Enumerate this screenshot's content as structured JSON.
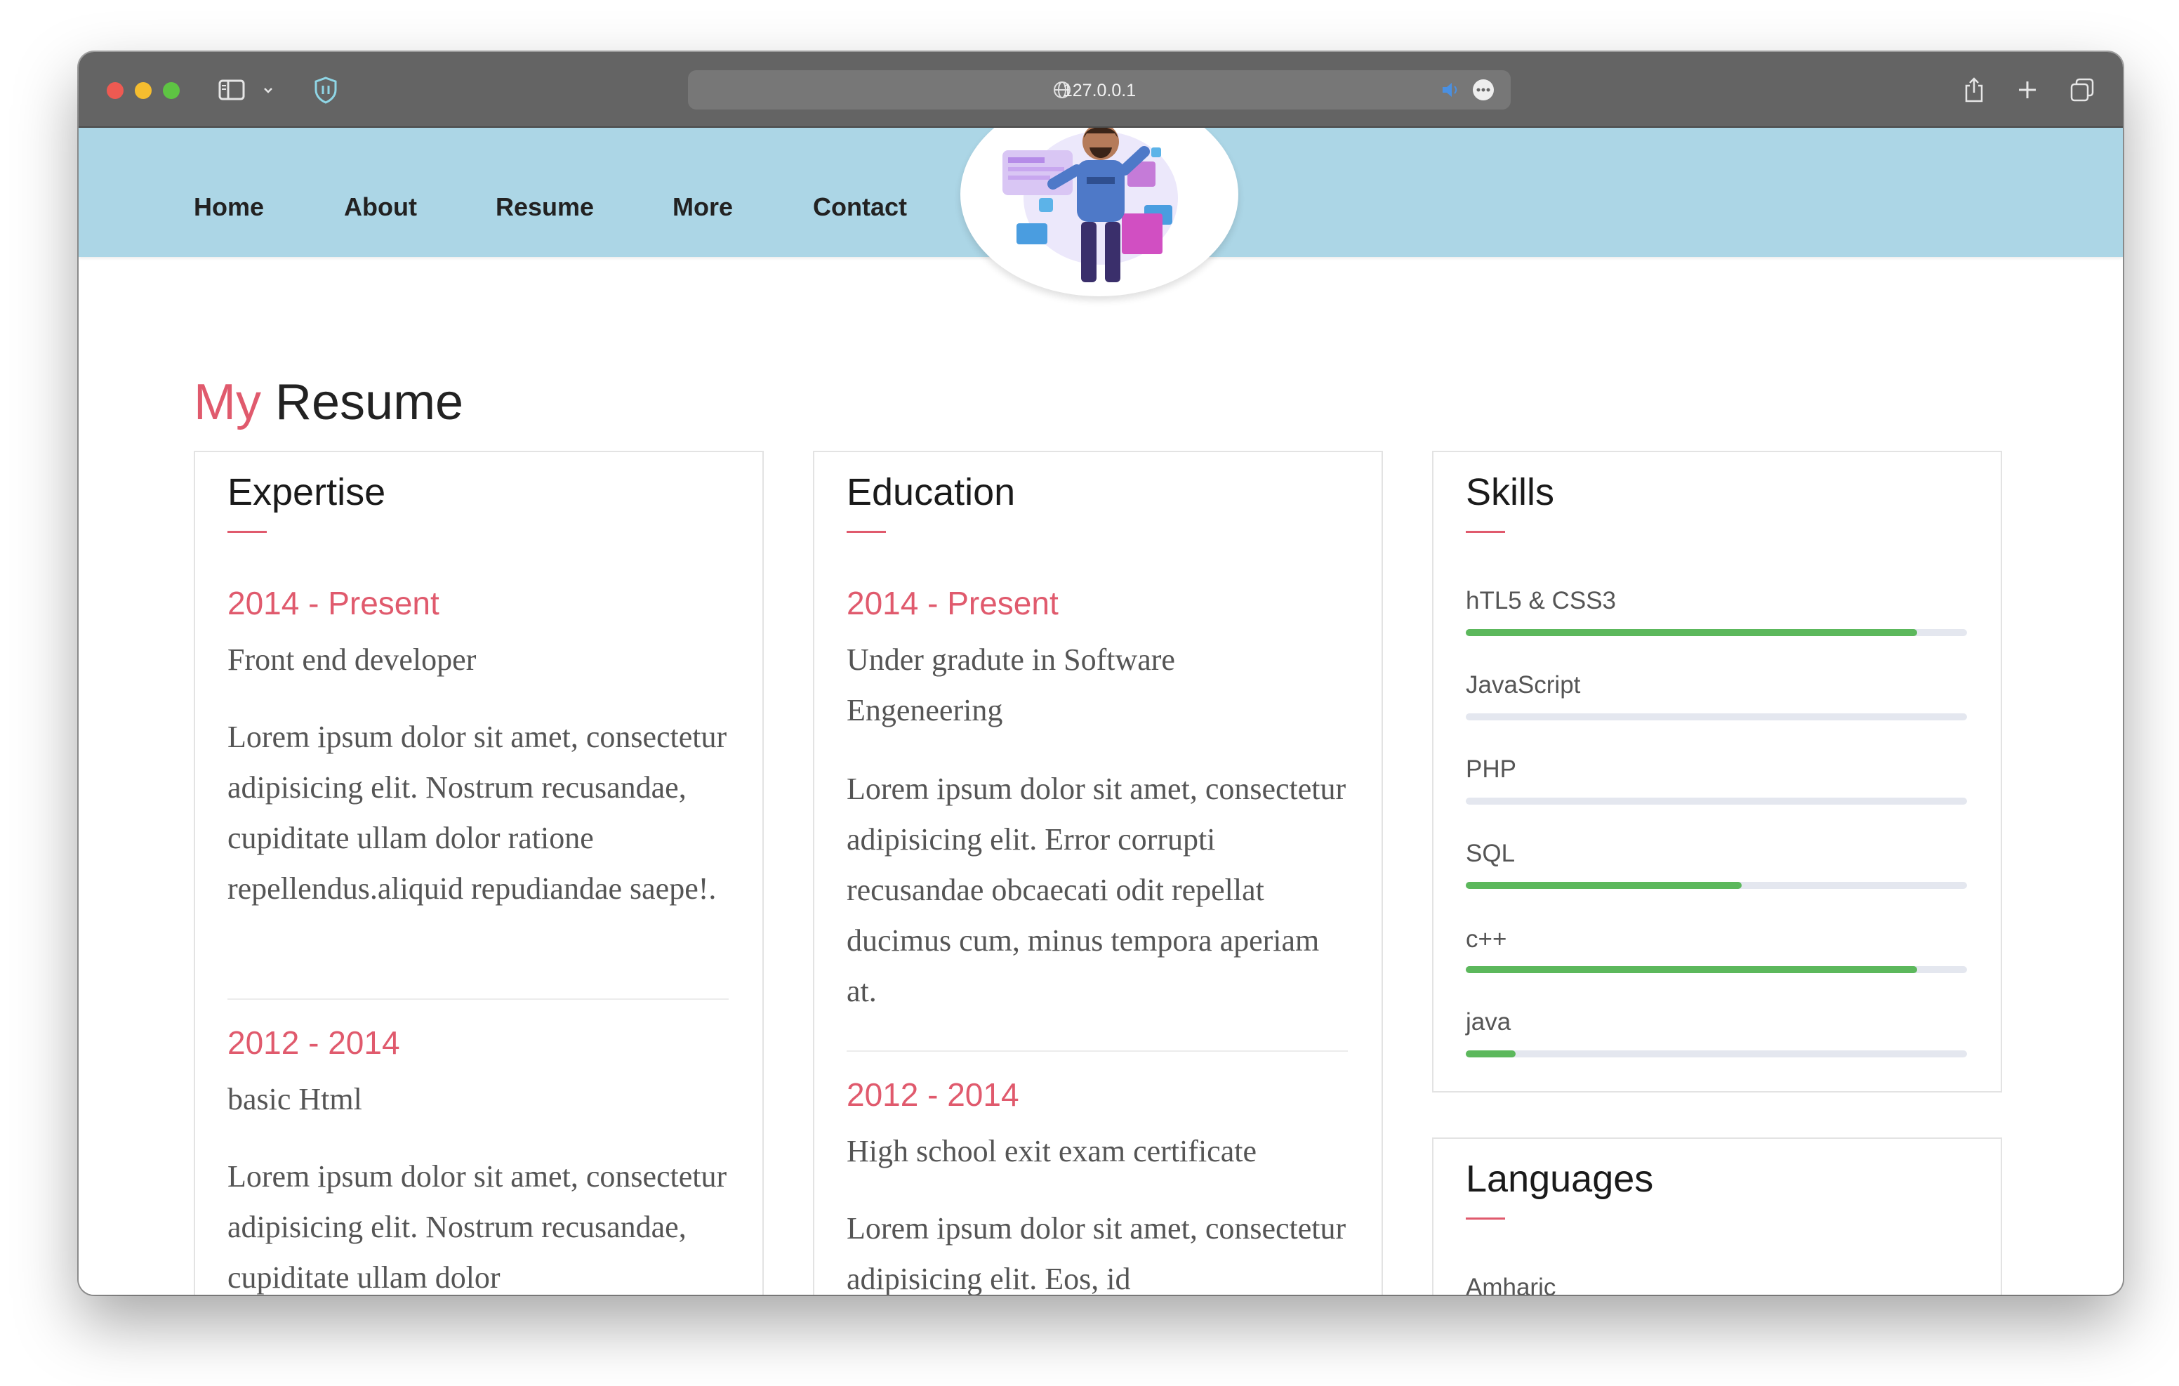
{
  "browser": {
    "url": "127.0.0.1"
  },
  "nav": {
    "items": [
      "Home",
      "About",
      "Resume",
      "More",
      "Contact"
    ]
  },
  "page": {
    "title_accent": "My",
    "title_rest": "Resume"
  },
  "expertise": {
    "title": "Expertise",
    "entries": [
      {
        "period": "2014 - Present",
        "role": "Front end developer",
        "description": "Lorem ipsum dolor sit amet, consectetur adipisicing elit. Nostrum recusandae, cupiditate ullam dolor ratione repellendus.aliquid repudiandae saepe!."
      },
      {
        "period": "2012 - 2014",
        "role": "basic Html",
        "description": "Lorem ipsum dolor sit amet, consectetur adipisicing elit. Nostrum recusandae, cupiditate ullam dolor"
      }
    ]
  },
  "education": {
    "title": "Education",
    "entries": [
      {
        "period": "2014 - Present",
        "role": "Under gradute in Software Engeneering",
        "description": "Lorem ipsum dolor sit amet, consectetur adipisicing elit. Error corrupti recusandae obcaecati odit repellat ducimus cum, minus tempora aperiam at."
      },
      {
        "period": "2012 - 2014",
        "role": "High school exit exam certificate",
        "description": "Lorem ipsum dolor sit amet, consectetur adipisicing elit. Eos, id"
      }
    ]
  },
  "skills": {
    "title": "Skills",
    "items": [
      {
        "name": "hTL5 & CSS3",
        "percent": 90
      },
      {
        "name": "JavaScript",
        "percent": 0
      },
      {
        "name": "PHP",
        "percent": 0
      },
      {
        "name": "SQL",
        "percent": 55
      },
      {
        "name": "c++",
        "percent": 90
      },
      {
        "name": "java",
        "percent": 10
      }
    ],
    "bar_color": "#5cb85c",
    "track_color": "#e4e7ef"
  },
  "languages": {
    "title": "Languages",
    "first_item": "Amharic"
  },
  "colors": {
    "accent": "#e05a6d",
    "navbar": "#acd6e6"
  }
}
